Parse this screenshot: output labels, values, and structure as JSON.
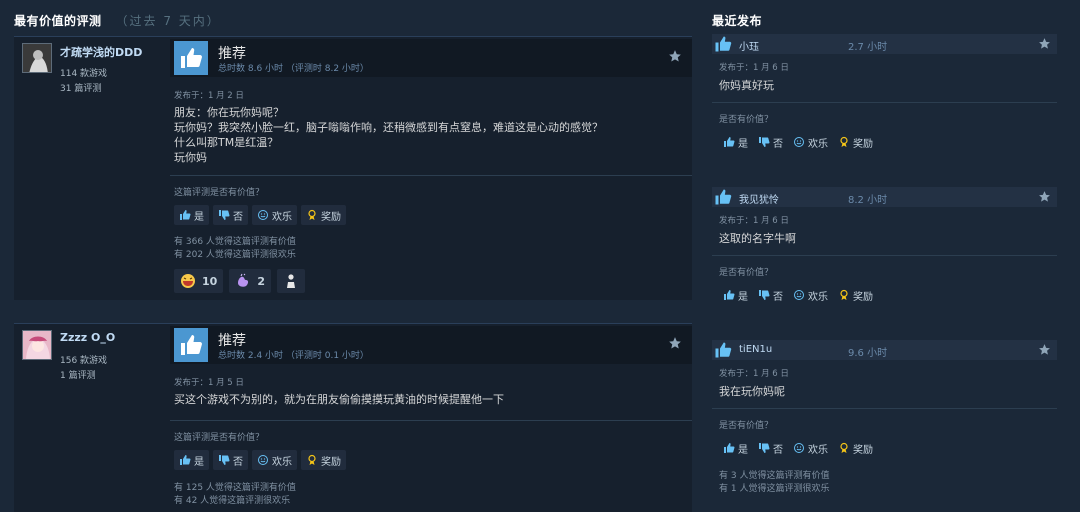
{
  "headings": {
    "most_helpful": "最有价值的评测",
    "most_helpful_sub": "（过去 7 天内）",
    "recent": "最近发布"
  },
  "reviews": [
    {
      "author": "才疏学浅的DDD",
      "games": "114 款游戏",
      "reviews_count": "31 篇评测",
      "recommendation": "推荐",
      "hours": "总时数 8.6 小时 （评测时 8.2 小时）",
      "posted": "发布于：1 月 2 日",
      "lines": [
        "朋友：你在玩你妈呢？",
        "玩你妈？我突然小脸一红，脑子嗡嗡作响，还稍微感到有点窒息，难道这是心动的感觉？",
        "什么叫那TM是红温？",
        "玩你妈"
      ],
      "helpful_q": "这篇评测是否有价值？",
      "buttons": {
        "yes": "是",
        "no": "否",
        "funny": "欢乐",
        "award": "奖励"
      },
      "helpful_count": "有 366 人觉得这篇评测有价值",
      "funny_count": "有 202 人觉得这篇评测很欢乐",
      "awards": [
        {
          "icon": "laughing-face-icon",
          "count": "10"
        },
        {
          "icon": "clap-icon",
          "count": "2"
        },
        {
          "icon": "trophy-figure-icon",
          "count": ""
        }
      ]
    },
    {
      "author": "Zzzz O_O",
      "games": "156 款游戏",
      "reviews_count": "1 篇评测",
      "recommendation": "推荐",
      "hours": "总时数 2.4 小时 （评测时 0.1 小时）",
      "posted": "发布于：1 月 5 日",
      "lines": [
        "买这个游戏不为别的，就为在朋友偷偷摸摸玩黄油的时候提醒他一下"
      ],
      "helpful_q": "这篇评测是否有价值？",
      "buttons": {
        "yes": "是",
        "no": "否",
        "funny": "欢乐",
        "award": "奖励"
      },
      "helpful_count": "有 125 人觉得这篇评测有价值",
      "funny_count": "有 42 人觉得这篇评测很欢乐"
    }
  ],
  "recent": [
    {
      "author": "小珏",
      "hours": "2.7 小时",
      "posted": "发布于：1 月 6 日",
      "text": "你妈真好玩",
      "helpful_q": "是否有价值？",
      "buttons": {
        "yes": "是",
        "no": "否",
        "funny": "欢乐",
        "award": "奖励"
      }
    },
    {
      "author": "我见犹怜",
      "hours": "8.2 小时",
      "posted": "发布于：1 月 6 日",
      "text": "这取的名字牛啊",
      "helpful_q": "是否有价值？",
      "buttons": {
        "yes": "是",
        "no": "否",
        "funny": "欢乐",
        "award": "奖励"
      }
    },
    {
      "author": "tiEN1u",
      "hours": "9.6 小时",
      "posted": "发布于：1 月 6 日",
      "text": "我在玩你妈呢",
      "helpful_q": "是否有价值？",
      "buttons": {
        "yes": "是",
        "no": "否",
        "funny": "欢乐",
        "award": "奖励"
      },
      "helpful_count": "有 3 人觉得这篇评测有价值",
      "funny_count": "有 1 人觉得这篇评测很欢乐"
    }
  ],
  "colors": {
    "accent": "#67c1f5",
    "thumb_bg": "#4b97d1",
    "background": "#1b2838"
  }
}
